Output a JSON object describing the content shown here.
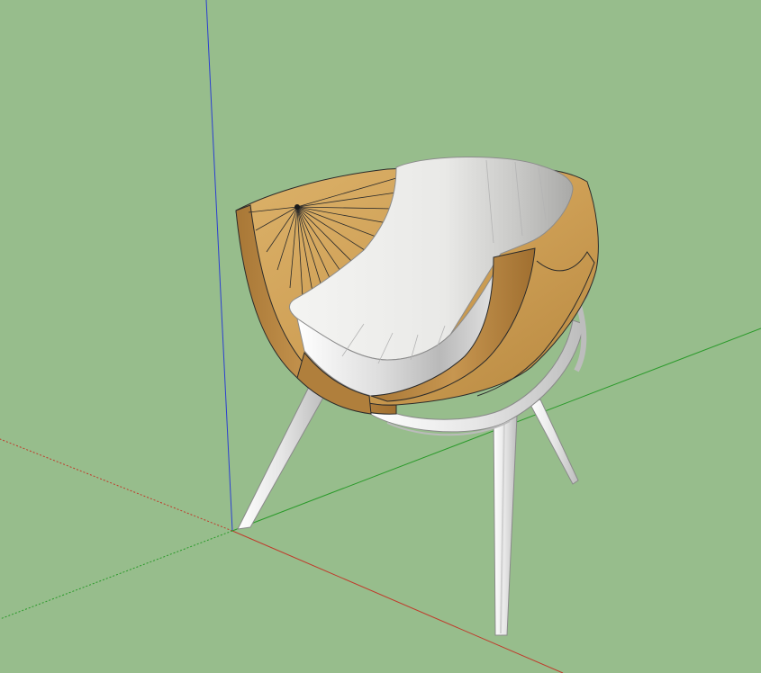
{
  "scene": {
    "background_color": "#97bd8c",
    "model": "chair",
    "axes": {
      "red": "#c03a2b",
      "green": "#2a9a2a",
      "blue": "#2b3fd0"
    },
    "materials": {
      "wood_light": "#d7ab62",
      "wood_mid": "#c89a52",
      "wood_dark": "#9c6e33",
      "cushion_light": "#f2f2f0",
      "cushion_mid": "#d6d6d4",
      "cushion_dark": "#a9a9a7",
      "metal_light": "#ffffff",
      "metal_shade": "#c9c9c9",
      "edge": "#2a2a2a"
    }
  }
}
